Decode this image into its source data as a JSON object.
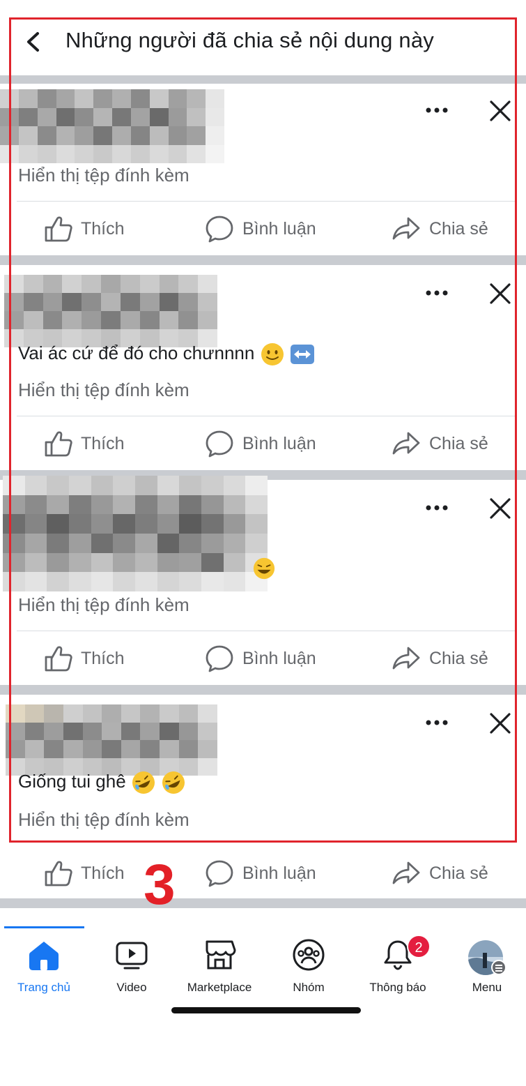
{
  "header": {
    "title": "Những người đã chia sẻ nội dung này"
  },
  "actions": {
    "like": "Thích",
    "comment": "Bình luận",
    "share": "Chia sẻ"
  },
  "posts": [
    {
      "text": "",
      "attachment": "Hiển thị tệp đính kèm"
    },
    {
      "text": "Vai ác cứ để đó cho chưnnnn",
      "attachment": "Hiển thị tệp đính kèm"
    },
    {
      "text": "",
      "attachment": "Hiển thị tệp đính kèm"
    },
    {
      "text": "Giống tui ghê",
      "attachment": "Hiển thị tệp đính kèm"
    }
  ],
  "annotation": {
    "step": "3",
    "frame_color": "#e0242c"
  },
  "nav": {
    "items": [
      {
        "label": "Trang chủ",
        "icon": "home-icon",
        "active": true
      },
      {
        "label": "Video",
        "icon": "video-icon"
      },
      {
        "label": "Marketplace",
        "icon": "marketplace-icon"
      },
      {
        "label": "Nhóm",
        "icon": "groups-icon"
      },
      {
        "label": "Thông báo",
        "icon": "bell-icon",
        "badge": "2"
      },
      {
        "label": "Menu",
        "icon": "avatar-icon"
      }
    ]
  },
  "colors": {
    "accent": "#1877f2",
    "badge": "#e41e3f",
    "separator": "#c9ccd1"
  }
}
